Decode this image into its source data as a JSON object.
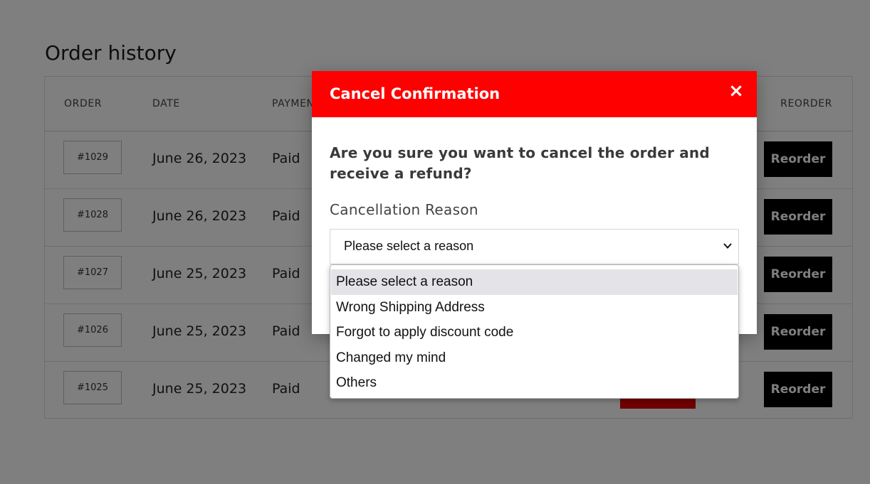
{
  "page": {
    "title": "Order history"
  },
  "table": {
    "headers": {
      "order": "ORDER",
      "date": "DATE",
      "payment": "PAYMENT",
      "reorder": "REORDER"
    },
    "rows": [
      {
        "order": "#1029",
        "date": "June 26, 2023",
        "payment": "Paid",
        "action": "Reorder"
      },
      {
        "order": "#1028",
        "date": "June 26, 2023",
        "payment": "Paid",
        "action": "Reorder"
      },
      {
        "order": "#1027",
        "date": "June 25, 2023",
        "payment": "Paid",
        "action": "Reorder"
      },
      {
        "order": "#1026",
        "date": "June 25, 2023",
        "payment": "Paid",
        "action": "Reorder"
      },
      {
        "order": "#1025",
        "date": "June 25, 2023",
        "payment": "Paid",
        "action": "Reorder"
      }
    ]
  },
  "modal": {
    "title": "Cancel Confirmation",
    "close_symbol": "×",
    "question": "Are you sure you want to cancel the order and receive a refund?",
    "reason_label": "Cancellation Reason",
    "select": {
      "value": "Please select a reason",
      "options": [
        "Please select a reason",
        "Wrong Shipping Address",
        "Forgot to apply discount code",
        "Changed my mind",
        "Others"
      ],
      "highlighted_index": 0
    }
  },
  "colors": {
    "header_red": "#ff0000",
    "button_black": "#000000",
    "overlay": "rgba(0,0,0,0.5)"
  },
  "icons": {
    "close": "close-icon",
    "chevron": "chevron-down-icon"
  }
}
